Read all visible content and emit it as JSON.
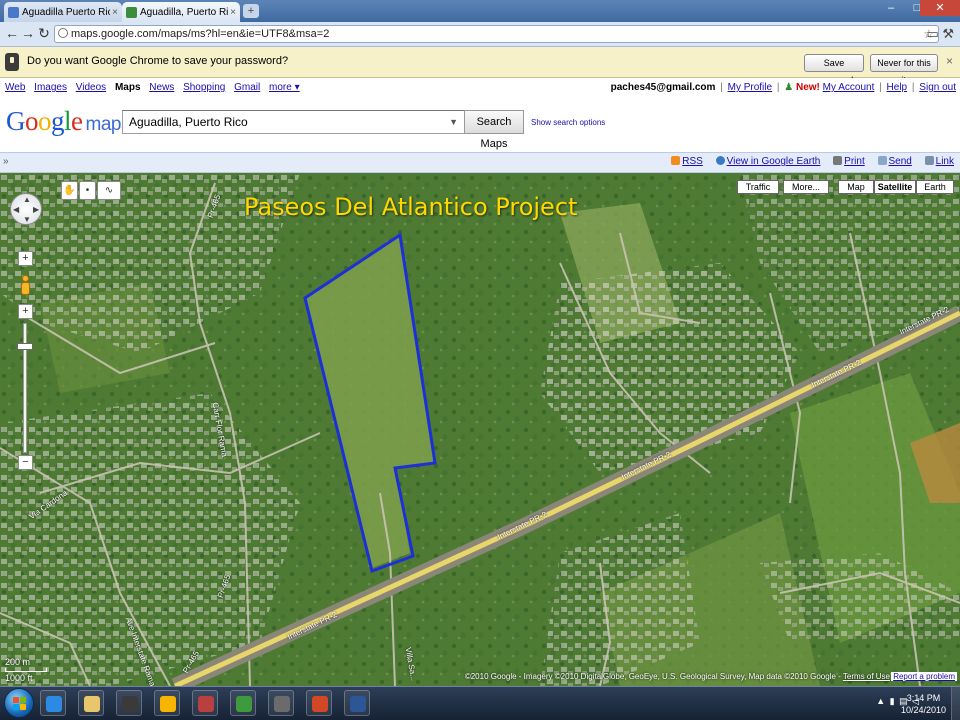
{
  "browser": {
    "tabs": [
      {
        "title": "Aguadilla Puerto Rico Cr...",
        "active": false,
        "favicon_color": "#4a78c8"
      },
      {
        "title": "Aguadilla, Puerto Rico - ...",
        "active": true,
        "favicon_color": "#3b8d3b"
      }
    ],
    "new_tab_icon": "plus-icon",
    "window_controls": {
      "minimize": "–",
      "maximize": "□",
      "close": "✕"
    },
    "nav": {
      "back": "←",
      "forward": "→",
      "reload": "↻"
    },
    "url": "maps.google.com/maps/ms?hl=en&ie=UTF8&msa=2",
    "tool_icons": "▭  ⚒"
  },
  "password_bar": {
    "message": "Do you want Google Chrome to save your password?",
    "save_label": "Save password",
    "never_label": "Never for this site",
    "close": "×"
  },
  "google_bar": {
    "links": [
      "Web",
      "Images",
      "Videos",
      "Maps",
      "News",
      "Shopping",
      "Gmail",
      "more ▾"
    ],
    "current": "Maps",
    "user": "paches45@gmail.com",
    "my_profile": "My Profile",
    "new_label": "New!",
    "my_account": "My Account",
    "help": "Help",
    "sign_out": "Sign out"
  },
  "header": {
    "logo_letters": [
      {
        "ch": "G",
        "color": "#1a57d1"
      },
      {
        "ch": "o",
        "color": "#d62d20"
      },
      {
        "ch": "o",
        "color": "#f2b200"
      },
      {
        "ch": "g",
        "color": "#1a57d1"
      },
      {
        "ch": "l",
        "color": "#169a3a"
      },
      {
        "ch": "e",
        "color": "#d62d20"
      }
    ],
    "logo_product": "maps",
    "search_value": "Aguadilla, Puerto Rico",
    "search_button": "Search Maps",
    "search_options": "Show search options"
  },
  "link_bar": {
    "collapse": "»",
    "links": [
      {
        "label": "RSS",
        "icon": "rss-icon",
        "color": "#f28c1f"
      },
      {
        "label": "View in Google Earth",
        "icon": "earth-icon",
        "color": "#3a7ac4"
      },
      {
        "label": "Print",
        "icon": "print-icon",
        "color": "#777777"
      },
      {
        "label": "Send",
        "icon": "email-icon",
        "color": "#8aa6c8"
      },
      {
        "label": "Link",
        "icon": "link-icon",
        "color": "#7a8fa9"
      }
    ]
  },
  "map": {
    "overlay_title": "Paseos Del Atlantico Project",
    "overlay_color": "#ffd800",
    "outline_color": "#1d2fd6",
    "type_buttons": [
      "Traffic",
      "More...",
      "Map",
      "Satellite",
      "Earth"
    ],
    "selected_type": "Satellite",
    "tools": [
      "hand-icon",
      "placemark-icon",
      "line-icon"
    ],
    "tool_glyphs": [
      "✋",
      "•",
      "∿"
    ],
    "controls": {
      "up": "▲",
      "down": "▼",
      "left": "◀",
      "right": "▶",
      "zoom_in": "+",
      "zoom_out": "−",
      "street_view_icon": "pegman-icon",
      "zoom_level": 0.84
    },
    "road_labels": [
      "Interstate PR-2",
      "Interstate PR-2",
      "Interstate PR-2",
      "Interstate PR-2",
      "Interstate PR-2",
      "Via Cardona",
      "Pr-465",
      "Pr-465",
      "Pr-465",
      "Carr Flor Rama",
      "Ave Interstate Rama",
      "Villa Sa..."
    ],
    "scale_primary": "200 m",
    "scale_secondary": "1000 ft",
    "copyright": "©2010 Google - Imagery ©2010 DigitalGlobe, GeoEye, U.S. Geological Survey, Map data ©2010 Google -",
    "terms": "Terms of Use",
    "report": "Report a problem"
  },
  "taskbar": {
    "start": "start-orb",
    "apps": [
      {
        "name": "internet-explorer-icon",
        "color": "#2d8ae2"
      },
      {
        "name": "explorer-folder-icon",
        "color": "#e8c66a"
      },
      {
        "name": "media-center-icon",
        "color": "#3a3a3a"
      },
      {
        "name": "media-player-icon",
        "color": "#f7b500"
      },
      {
        "name": "games-icon",
        "color": "#b94040"
      },
      {
        "name": "chrome-icon",
        "color": "#3d9b3d"
      },
      {
        "name": "checkers-icon",
        "color": "#6b6b6b"
      },
      {
        "name": "powerpoint-icon",
        "color": "#d24726"
      },
      {
        "name": "word-icon",
        "color": "#2b5797"
      }
    ],
    "tray": "▲ ▮ ▤ ◁",
    "time": "3:14 PM",
    "date": "10/24/2010"
  }
}
